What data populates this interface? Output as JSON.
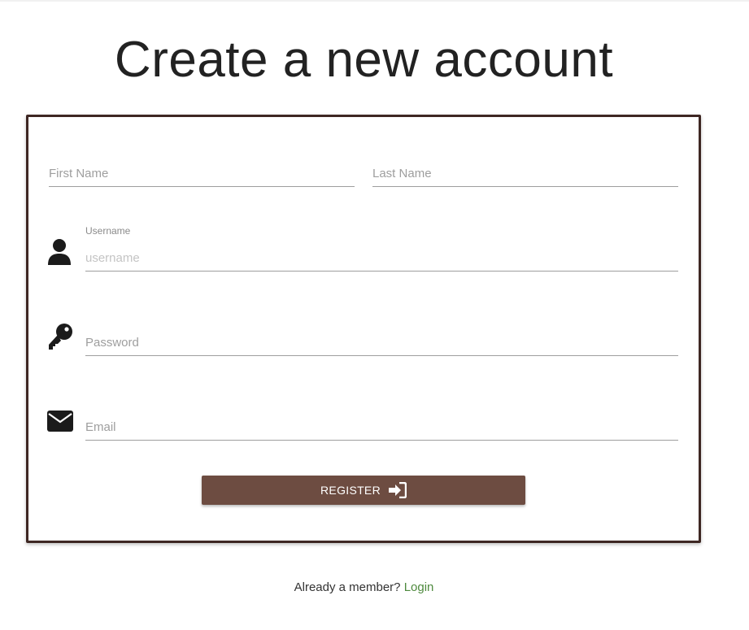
{
  "page": {
    "title": "Create a new account"
  },
  "form": {
    "first_name_placeholder": "First Name",
    "last_name_placeholder": "Last Name",
    "username_label": "Username",
    "username_placeholder": "username",
    "password_placeholder": "Password",
    "email_placeholder": "Email",
    "register_label": "REGISTER"
  },
  "icons": {
    "username": "person-icon",
    "password": "key-icon",
    "email": "envelope-icon",
    "register": "sign-in-icon"
  },
  "footer": {
    "prompt": "Already a member?",
    "login_link": "Login"
  },
  "colors": {
    "card_border": "#3e2723",
    "button_bg": "#6d4c41",
    "link": "#4e8a3e"
  }
}
